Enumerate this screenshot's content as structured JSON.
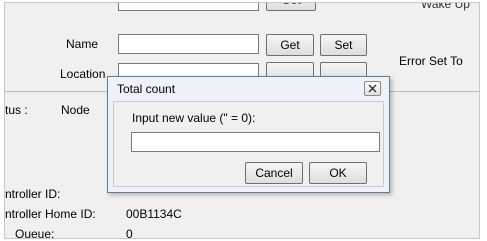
{
  "form": {
    "name_label": "Name",
    "location_label": "Location",
    "status_label": "tus :",
    "status_value": "Node",
    "get_label": "Get",
    "set_label": "Set",
    "top_get_partial": "Get",
    "wake_partial": "Wake Up",
    "error_set_label": "Error Set To",
    "controller_id_label": "ntroller ID:",
    "controller_home_id_label": "ntroller Home ID:",
    "controller_home_id_value": "00B1134C",
    "queue_label": "Queue:",
    "queue_value": "0"
  },
  "dialog": {
    "title": "Total count",
    "prompt": "Input new value (\" = 0):",
    "input_value": "",
    "cancel_label": "Cancel",
    "ok_label": "OK"
  }
}
